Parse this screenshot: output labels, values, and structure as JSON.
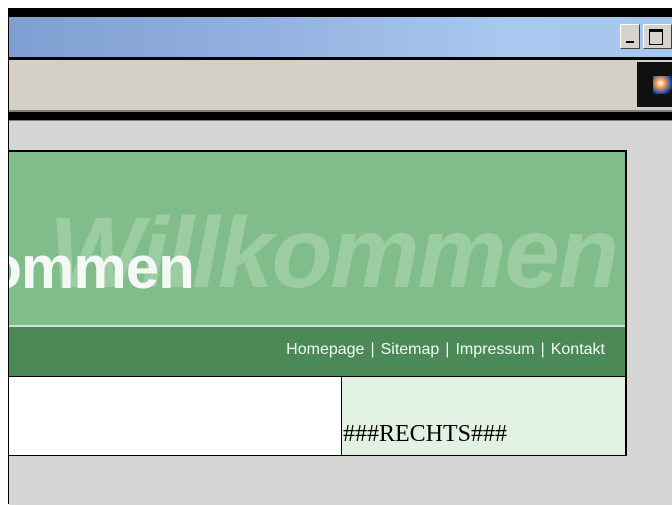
{
  "window": {
    "minimize_label": "_",
    "maximize_label": "□"
  },
  "header": {
    "title": "kommen",
    "watermark": "Willkommen"
  },
  "nav": {
    "links": [
      "Homepage",
      "Sitemap",
      "Impressum",
      "Kontakt"
    ],
    "separator": "|"
  },
  "content": {
    "right_placeholder": "###RECHTS###"
  },
  "colors": {
    "header_bg": "#80bd8a",
    "nav_bg": "#4b8a57",
    "right_column_bg": "#e1f2e3",
    "viewport_bg": "#d6d6d6"
  }
}
